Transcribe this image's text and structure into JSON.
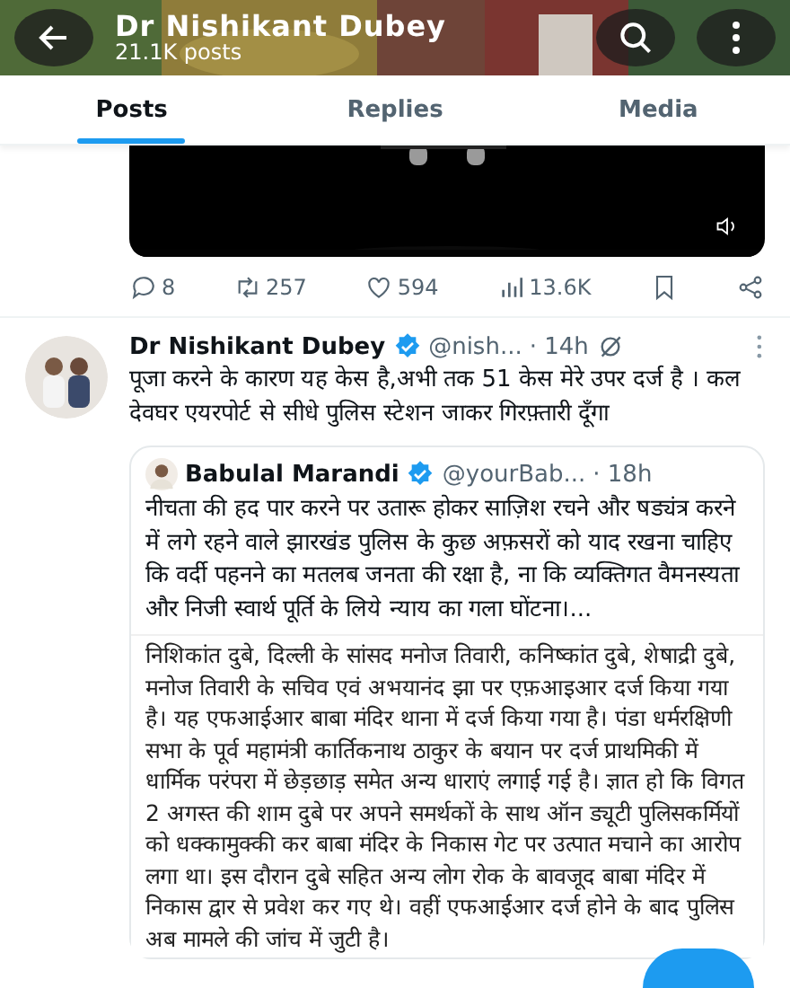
{
  "header": {
    "title": "Dr Nishikant Dubey",
    "subtitle": "21.1K posts"
  },
  "tabs": [
    {
      "label": "Posts",
      "selected": true
    },
    {
      "label": "Replies",
      "selected": false
    },
    {
      "label": "Media",
      "selected": false
    }
  ],
  "previous_post": {
    "actions": [
      {
        "kind": "reply",
        "count": "8"
      },
      {
        "kind": "repost",
        "count": "257"
      },
      {
        "kind": "like",
        "count": "594"
      },
      {
        "kind": "views",
        "count": "13.6K"
      },
      {
        "kind": "bookmark"
      },
      {
        "kind": "share"
      }
    ]
  },
  "post": {
    "author": "Dr Nishikant Dubey",
    "verified": true,
    "handle": "@nish...",
    "time": "· 14h",
    "text": "पूजा करने के कारण यह केस है,अभी तक 51 केस मेरे उपर दर्ज है । कल देवघर एयरपोर्ट से सीधे पुलिस स्टेशन जाकर गिरफ़्तारी दूँगा",
    "quote": {
      "author": "Babulal Marandi",
      "verified": true,
      "handle": "@yourBab...",
      "time": "· 18h",
      "text": "नीचता की हद पार करने पर उतारू होकर साज़िश रचने और षड्यंत्र करने में लगे रहने वाले झारखंड पुलिस के कुछ अफ़सरों को याद रखना चाहिए कि वर्दी पहनने का मतलब जनता की रक्षा है, ना कि व्यक्तिगत वैमनस्यता और निजी स्वार्थ पूर्ति के लिये न्याय का गला घोंटना।...",
      "clipping": "निशिकांत दुबे, दिल्ली के सांसद मनोज तिवारी, कनिष्कांत दुबे, शेषाद्री दुबे, मनोज तिवारी के सचिव एवं अभयानंद झा पर एफ़आइआर दर्ज किया गया है। यह एफआईआर बाबा मंदिर थाना में दर्ज किया गया है। पंडा धर्मरक्षिणी सभा के पूर्व महामंत्री कार्तिकनाथ ठाकुर के बयान पर दर्ज प्राथमिकी में धार्मिक परंपरा में छेड़छाड़ समेत अन्य धाराएं लगाई गई है। ज्ञात हो कि विगत 2 अगस्त की शाम दुबे पर अपने समर्थकों के साथ ऑन ड्यूटी पुलिसकर्मियों को धक्कामुक्की कर बाबा मंदिर के निकास गेट पर उत्पात मचाने का आरोप लगा था। इस दौरान दुबे सहित अन्य लोग रोक के बावजूद बाबा मंदिर में निकास द्वार से प्रवेश कर गए थे। वहीं एफआईआर दर्ज होने के बाद पुलिस अब मामले की जांच में जुटी है।"
    }
  }
}
